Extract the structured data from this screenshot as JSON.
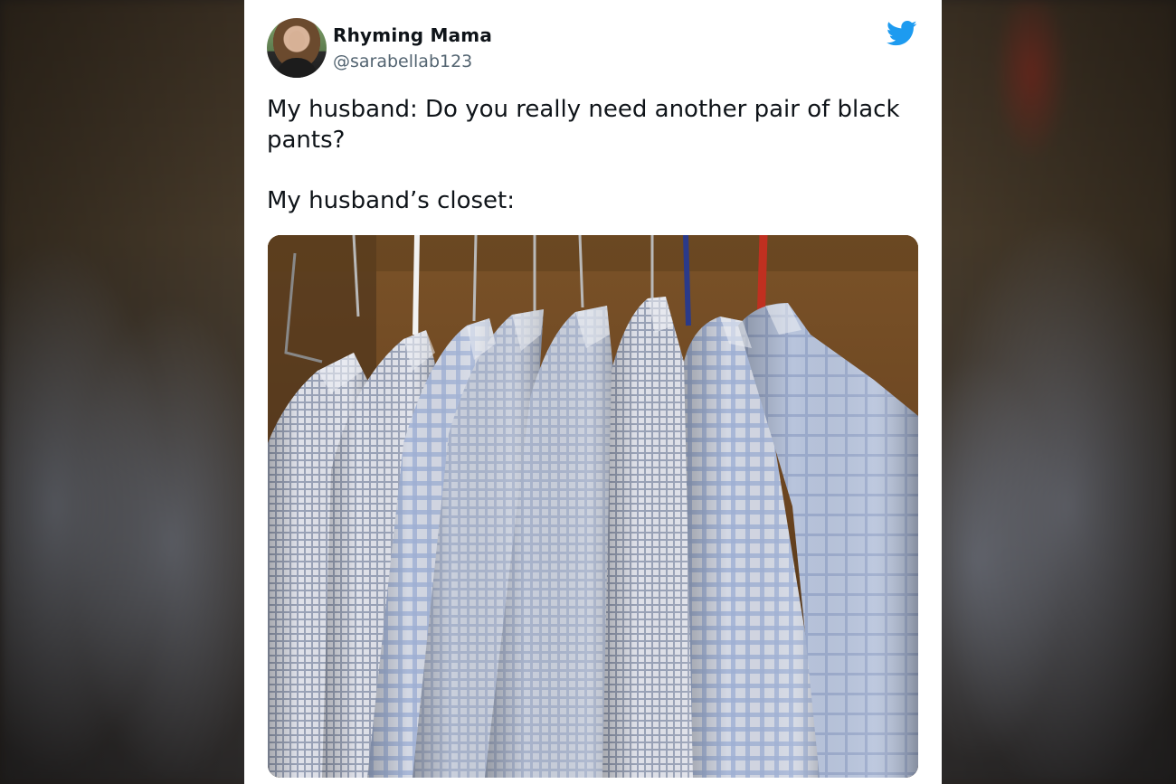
{
  "background": {
    "description_color": "#3a2f22"
  },
  "tweet": {
    "author_name": "Rhyming Mama",
    "author_handle": "@sarabellab123",
    "text_line1": "My husband: Do you really need another pair of black pants?",
    "text_line2": "My husband’s closet:",
    "platform_icon": "twitter-bird-icon",
    "brand_color": "#1d9bf0"
  },
  "media": {
    "icon": "closet-photo"
  }
}
